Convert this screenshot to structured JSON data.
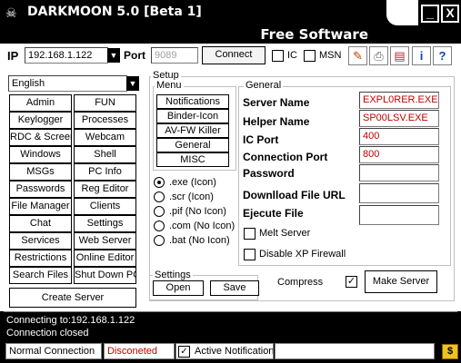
{
  "window": {
    "title": "DARKMOON 5.0 [Beta 1]",
    "banner": "Free Software",
    "minimize_glyph": "_",
    "close_glyph": "X"
  },
  "connection": {
    "ip_label": "IP",
    "ip_value": "192.168.1.122",
    "port_label": "Port",
    "port_placeholder": "9089",
    "connect_label": "Connect",
    "ic_label": "IC",
    "msn_label": "MSN"
  },
  "toolbar_icons": [
    "paint-icon",
    "printer-icon",
    "notebook-icon",
    "info-icon",
    "help-icon"
  ],
  "language": {
    "value": "English"
  },
  "side_buttons": [
    [
      "Admin",
      "FUN"
    ],
    [
      "Keylogger",
      "Processes"
    ],
    [
      "RDC & Screen",
      "Webcam"
    ],
    [
      "Windows",
      "Shell"
    ],
    [
      "MSGs",
      "PC Info"
    ],
    [
      "Passwords",
      "Reg Editor"
    ],
    [
      "File Manager",
      "Clients"
    ],
    [
      "Chat",
      "Settings"
    ],
    [
      "Services",
      "Web Server"
    ],
    [
      "Restrictions",
      "Online Editor"
    ],
    [
      "Search Files",
      "Shut Down PC"
    ]
  ],
  "create_server_label": "Create Server",
  "setup": {
    "title": "Setup",
    "menu_title": "Menu",
    "menu_items": [
      "Notifications",
      "Binder-Icon",
      "AV-FW Killer",
      "General",
      "MISC"
    ],
    "extensions": [
      ".exe (Icon)",
      ".scr (Icon)",
      ".pif (No Icon)",
      ".com (No Icon)",
      ".bat (No Icon)"
    ],
    "selected_extension": ".exe (Icon)"
  },
  "general": {
    "title": "General",
    "server_name_label": "Server Name",
    "server_name_value": "EXPL0RER.EXE",
    "helper_name_label": "Helper Name",
    "helper_name_value": "SP00LSV.EXE",
    "ic_port_label": "IC Port",
    "ic_port_value": "400",
    "connection_port_label": "Connection Port",
    "connection_port_value": "800",
    "password_label": "Password",
    "download_url_label": "Downlload File URL",
    "ejecute_file_label": "Ejecute File",
    "melt_server_label": "Melt Server",
    "disable_xp_firewall_label": "Disable XP Firewall"
  },
  "settings": {
    "title": "Settings",
    "open_label": "Open",
    "save_label": "Save"
  },
  "compress_label": "Compress",
  "compress_checked": true,
  "make_server_label": "Make Server",
  "log_lines": [
    "Connecting to:192.168.1.122",
    "Connection closed"
  ],
  "statusbar": {
    "connection_type": "Normal Connection",
    "state": "Disconeted",
    "active_notification_label": "Active Notification",
    "active_notification_checked": true,
    "dollar_glyph": "$"
  },
  "colors": {
    "background": "#000000",
    "panel": "#ffffff",
    "accent_red": "#c00000",
    "dollar_bg": "#f0c020"
  }
}
